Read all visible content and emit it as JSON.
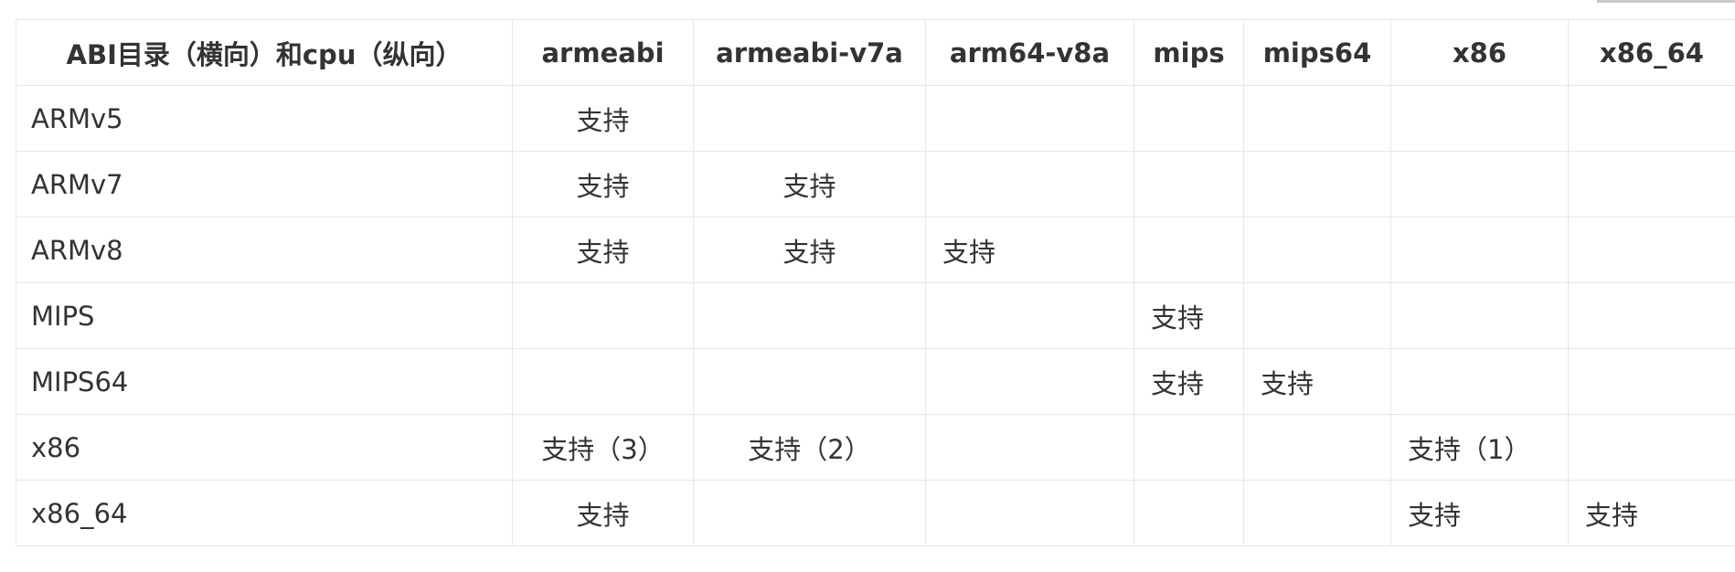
{
  "table": {
    "headers": [
      "ABI目录（横向）和cpu（纵向）",
      "armeabi",
      "armeabi-v7a",
      "arm64-v8a",
      "mips",
      "mips64",
      "x86",
      "x86_64"
    ],
    "rows": [
      {
        "cpu": "ARMv5",
        "cells": [
          "支持",
          "",
          "",
          "",
          "",
          "",
          ""
        ]
      },
      {
        "cpu": "ARMv7",
        "cells": [
          "支持",
          "支持",
          "",
          "",
          "",
          "",
          ""
        ]
      },
      {
        "cpu": "ARMv8",
        "cells": [
          "支持",
          "支持",
          "支持",
          "",
          "",
          "",
          ""
        ]
      },
      {
        "cpu": "MIPS",
        "cells": [
          "",
          "",
          "",
          "支持",
          "",
          "",
          ""
        ]
      },
      {
        "cpu": "MIPS64",
        "cells": [
          "",
          "",
          "",
          "支持",
          "支持",
          "",
          ""
        ]
      },
      {
        "cpu": "x86",
        "cells": [
          "支持（3）",
          "支持（2）",
          "",
          "",
          "",
          "支持（1）",
          ""
        ]
      },
      {
        "cpu": "x86_64",
        "cells": [
          "支持",
          "",
          "",
          "",
          "",
          "支持",
          "支持"
        ]
      }
    ]
  }
}
